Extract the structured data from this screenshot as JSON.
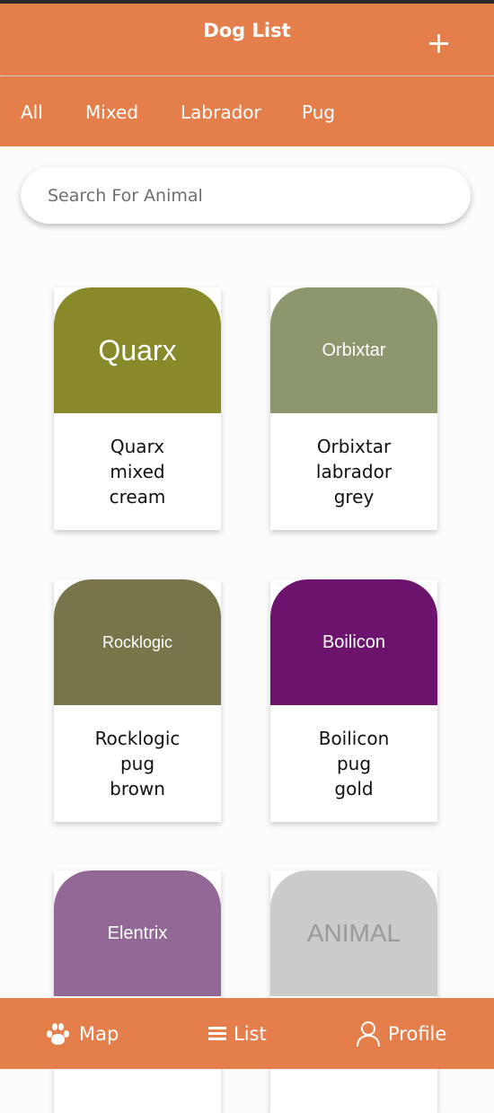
{
  "header": {
    "title": "Dog List",
    "add_icon": "plus-icon"
  },
  "tabs": [
    {
      "label": "All"
    },
    {
      "label": "Mixed"
    },
    {
      "label": "Labrador"
    },
    {
      "label": "Pug"
    }
  ],
  "search": {
    "placeholder": "Search For Animal",
    "value": ""
  },
  "cards": [
    {
      "image_text": "Quarx",
      "name": "Quarx",
      "breed": "mixed",
      "color": "cream",
      "image_bg": "#888a2a",
      "image_fg": "#ffffff"
    },
    {
      "image_text": "Orbixtar",
      "name": "Orbixtar",
      "breed": "labrador",
      "color": "grey",
      "image_bg": "#8c976d",
      "image_fg": "#ffffff"
    },
    {
      "image_text": "Rocklogic",
      "name": "Rocklogic",
      "breed": "pug",
      "color": "brown",
      "image_bg": "#777549",
      "image_fg": "#ffffff"
    },
    {
      "image_text": "Boilicon",
      "name": "Boilicon",
      "breed": "pug",
      "color": "gold",
      "image_bg": "#6c146d",
      "image_fg": "#ffffff"
    },
    {
      "image_text": "Elentrix",
      "name": "",
      "breed": "",
      "color": "",
      "image_bg": "#926896",
      "image_fg": "#ffffff"
    },
    {
      "image_text": "ANIMAL",
      "name": "",
      "breed": "",
      "color": "",
      "image_bg": "#cbcbcb",
      "image_fg": "#9a9a9a"
    }
  ],
  "bottom_nav": [
    {
      "label": "Map",
      "icon": "paw-icon"
    },
    {
      "label": "List",
      "icon": "list-icon"
    },
    {
      "label": "Profile",
      "icon": "person-icon"
    }
  ],
  "colors": {
    "accent": "#e47e4b",
    "background": "#fcfcfd"
  }
}
